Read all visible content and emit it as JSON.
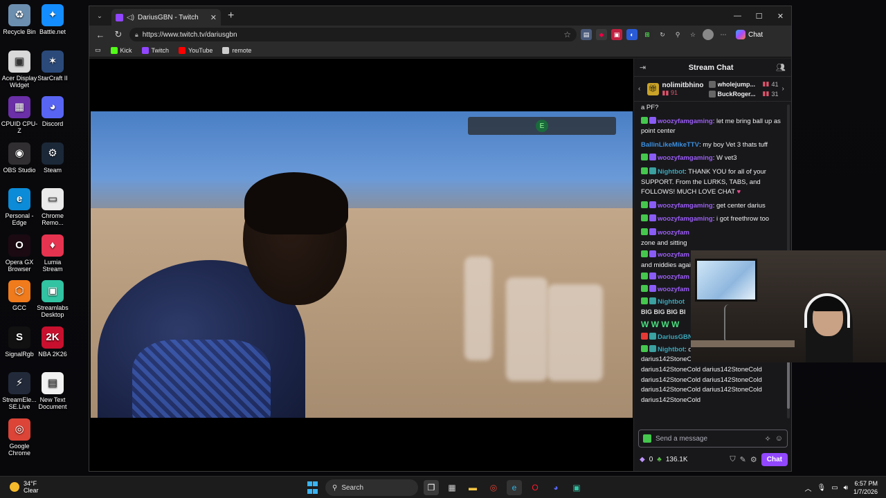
{
  "desktop": {
    "icons": [
      {
        "label": "Recycle Bin",
        "icon": "recycle-bin-icon",
        "color": "#6c8fb0",
        "glyph": "♻"
      },
      {
        "label": "Battle.net",
        "icon": "battlenet-icon",
        "color": "#148eff",
        "glyph": "✦"
      },
      {
        "label": "Acer Display Widget",
        "icon": "acer-widget-icon",
        "color": "#d9d9d9",
        "glyph": "▣"
      },
      {
        "label": "StarCraft II",
        "icon": "starcraft-icon",
        "color": "#2b4a7a",
        "glyph": "✶"
      },
      {
        "label": "CPUID CPU-Z",
        "icon": "cpuz-icon",
        "color": "#6b2fa8",
        "glyph": "▦"
      },
      {
        "label": "Discord",
        "icon": "discord-icon",
        "color": "#5865f2",
        "glyph": "◕"
      },
      {
        "label": "OBS Studio",
        "icon": "obs-icon",
        "color": "#302e31",
        "glyph": "◉"
      },
      {
        "label": "Steam",
        "icon": "steam-icon",
        "color": "#1b2838",
        "glyph": "⚙"
      },
      {
        "label": "Personal - Edge",
        "icon": "edge-icon",
        "color": "#0c8cd8",
        "glyph": "e"
      },
      {
        "label": "Chrome Remo...",
        "icon": "chrome-remote-icon",
        "color": "#eaeaea",
        "glyph": "▭"
      },
      {
        "label": "Opera GX Browser",
        "icon": "opera-gx-icon",
        "color": "#1b0a12",
        "glyph": "O"
      },
      {
        "label": "Lumia Stream",
        "icon": "lumia-icon",
        "color": "#e6334f",
        "glyph": "♦"
      },
      {
        "label": "GCC",
        "icon": "gcc-icon",
        "color": "#f07b1c",
        "glyph": "⬡"
      },
      {
        "label": "Streamlabs Desktop",
        "icon": "streamlabs-icon",
        "color": "#31c3a2",
        "glyph": "▣"
      },
      {
        "label": "SignalRgb",
        "icon": "signalrgb-icon",
        "color": "#111111",
        "glyph": "S"
      },
      {
        "label": "NBA 2K26",
        "icon": "nba2k-icon",
        "color": "#c8102e",
        "glyph": "2K"
      },
      {
        "label": "StreamEle... SE.Live",
        "icon": "streamelements-icon",
        "color": "#222a3a",
        "glyph": "⚡"
      },
      {
        "label": "New Text Document",
        "icon": "text-document-icon",
        "color": "#f2f2f2",
        "glyph": "▤"
      },
      {
        "label": "Google Chrome",
        "icon": "chrome-icon",
        "color": "#db4437",
        "glyph": "◎"
      }
    ]
  },
  "browser": {
    "tab_title": "DariusGBN - Twitch",
    "url": "https://www.twitch.tv/dariusgbn",
    "copilot_label": "Chat",
    "bookmarks": [
      {
        "label": "Kick",
        "color": "#53fc18"
      },
      {
        "label": "Twitch",
        "color": "#9146ff"
      },
      {
        "label": "YouTube",
        "color": "#ff0000"
      },
      {
        "label": "remote",
        "color": "#cccccc"
      }
    ]
  },
  "chat": {
    "title": "Stream Chat",
    "leaderboard": {
      "top_name": "nolimitbhino",
      "top_count": "91",
      "others": [
        {
          "name": "wholejump...",
          "count": "41"
        },
        {
          "name": "BuckRoger...",
          "count": "31"
        }
      ]
    },
    "partial_top": "a PF?",
    "messages": [
      {
        "user": "woozyfamgaming",
        "text": ": let me bring ball up as point center"
      },
      {
        "user": "BallinLikeMikeTTV",
        "text": ": my boy Vet 3 thats tuff"
      },
      {
        "user": "woozyfamgaming",
        "text": ": W vet3"
      },
      {
        "user": "Nightbot",
        "text": ": THANK YOU for all of your SUPPORT. From the LURKS, TABS, and FOLLOWS! MUCH LOVE CHAT"
      },
      {
        "user": "woozyfamgaming",
        "text": ": get center darius"
      },
      {
        "user": "woozyfamgaming",
        "text": ": i got freethrow too"
      }
    ],
    "obscured": [
      {
        "user": "woozyfam",
        "text": "zone and sitting"
      },
      {
        "user": "woozyfam",
        "text": "and middies agai"
      },
      {
        "user": "woozyfam",
        "text": ""
      },
      {
        "user": "woozyfam",
        "text": ""
      },
      {
        "user": "Nightbot",
        "text": "BIG BIG BIG BI"
      },
      {
        "user": "",
        "text": "W W W W"
      },
      {
        "user": "DariusGBN",
        "text": ""
      }
    ],
    "last_message": {
      "user": "Nightbot",
      "text": ": darius142StoneCold darius142StoneCold darius142StoneCold darius142StoneCold darius142StoneCold darius142StoneCold darius142StoneCold darius142StoneCold darius142StoneCold darius142StoneCold"
    },
    "input_placeholder": "Send a message",
    "points": "0",
    "channel_points": "136.1K",
    "send_label": "Chat"
  },
  "taskbar": {
    "temp": "34°F",
    "weather": "Clear",
    "search_placeholder": "Search",
    "time": "6:57 PM",
    "date": "1/7/2026"
  }
}
